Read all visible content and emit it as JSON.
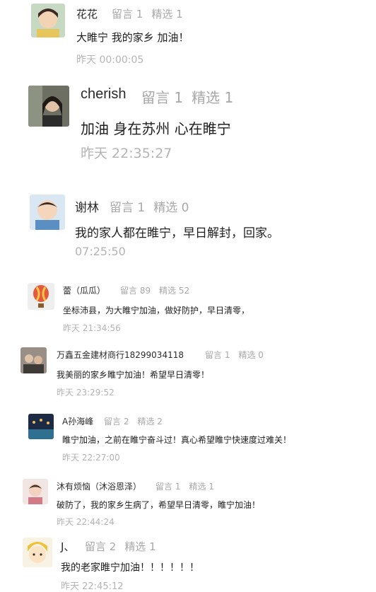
{
  "comments": [
    {
      "name": "花花",
      "leave": "留言 1",
      "featured": "精选 1",
      "text": "大睢宁 我的家乡 加油！",
      "time": "昨天 00:00:05"
    },
    {
      "name": "cherish",
      "leave": "留言 1",
      "featured": "精选 1",
      "text": "加油 身在苏州 心在睢宁",
      "time": "昨天 22:35:27"
    },
    {
      "name": "谢林",
      "leave": "留言 1",
      "featured": "精选 0",
      "text": "我的家人都在睢宁，早日解封，回家。",
      "time": "07:25:50"
    },
    {
      "name": "蕾（瓜瓜）",
      "leave": "留言 89",
      "featured": "精选 52",
      "text": "坐标沛县，为大睢宁加油，做好防护，早日清零，",
      "time": "昨天 21:34:56"
    },
    {
      "name": "万鑫五金建材商行18299034118",
      "leave": "留言 1",
      "featured": "精选 0",
      "text": "我美丽的家乡睢宁加油！希望早日清零！",
      "time": "昨天 23:29:52"
    },
    {
      "name": "A孙海峰",
      "leave": "留言 2",
      "featured": "精选 2",
      "text": "睢宁加油，之前在睢宁奋斗过！真心希望睢宁快速度过难关！",
      "time": "昨天 22:27:00"
    },
    {
      "name": "沐有烦恼（沐浴恩泽）",
      "leave": "留言 1",
      "featured": "精选 1",
      "text": "破防了，我的家乡生病了，希望早日清零，睢宁加油！",
      "time": "昨天 22:44:24"
    },
    {
      "name": "J、",
      "leave": "留言 2",
      "featured": "精选 1",
      "text": "我的老家睢宁加油！！！！！！",
      "time": "昨天 22:45:12"
    }
  ],
  "avatars": [
    "child-photo-avatar",
    "woman-photo-avatar",
    "baby-photo-avatar",
    "hot-air-balloon-avatar",
    "group-photo-avatar",
    "night-scene-avatar",
    "girl-photo-avatar",
    "cartoon-avatar"
  ]
}
